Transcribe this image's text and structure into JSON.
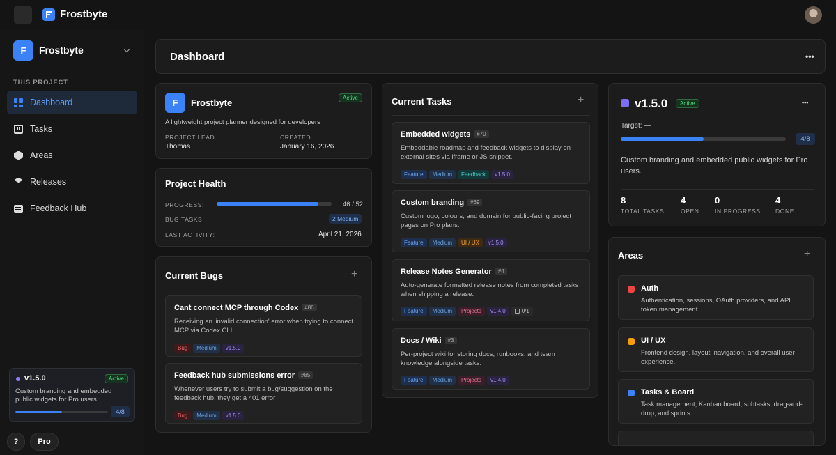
{
  "app": {
    "name": "Frostbyte"
  },
  "sidebar": {
    "project_initial": "F",
    "project_name": "Frostbyte",
    "section_label": "THIS PROJECT",
    "items": [
      {
        "label": "Dashboard",
        "icon": "dashboard-icon",
        "active": true
      },
      {
        "label": "Tasks",
        "icon": "tasks-icon"
      },
      {
        "label": "Areas",
        "icon": "cube-icon"
      },
      {
        "label": "Releases",
        "icon": "layers-icon"
      },
      {
        "label": "Feedback Hub",
        "icon": "chat-icon"
      }
    ],
    "release": {
      "version": "v1.5.0",
      "status": "Active",
      "description": "Custom branding and embedded public widgets for Pro users.",
      "progress": 0.5,
      "count": "4/8"
    },
    "help_label": "?",
    "pro_label": "Pro"
  },
  "header": {
    "title": "Dashboard",
    "more": "•••"
  },
  "project_card": {
    "initial": "F",
    "name": "Frostbyte",
    "status": "Active",
    "description": "A lightweight project planner designed for developers",
    "lead_label": "PROJECT LEAD",
    "lead": "Thomas",
    "created_label": "CREATED",
    "created": "January 16, 2026"
  },
  "health": {
    "title": "Project Health",
    "progress_label": "PROGRESS:",
    "progress": 0.885,
    "progress_text": "46 / 52",
    "bug_label": "BUG TASKS:",
    "bug_value": "2 Medium",
    "activity_label": "LAST ACTIVITY:",
    "activity_value": "April 21, 2026"
  },
  "bugs": {
    "title": "Current Bugs",
    "add": "+",
    "items": [
      {
        "title": "Cant connect MCP through Codex",
        "num": "#86",
        "desc": "Receiving an 'invalid connection' error when trying to connect MCP via Codex CLI.",
        "tags": [
          "Bug",
          "Medium",
          "v1.5.0"
        ]
      },
      {
        "title": "Feedback hub submissions error",
        "num": "#85",
        "desc": "Whenever users try to submit a bug/suggestion on the feedback hub, they get a 401 error",
        "tags": [
          "Bug",
          "Medium",
          "v1.5.0"
        ]
      }
    ]
  },
  "tasks": {
    "title": "Current Tasks",
    "add": "+",
    "items": [
      {
        "title": "Embedded widgets",
        "num": "#70",
        "desc": "Embeddable roadmap and feedback widgets to display on external sites via iframe or JS snippet.",
        "tags": [
          "Feature",
          "Medium",
          "Feedback",
          "v1.5.0"
        ]
      },
      {
        "title": "Custom branding",
        "num": "#69",
        "desc": "Custom logo, colours, and domain for public-facing project pages on Pro plans.",
        "tags": [
          "Feature",
          "Medium",
          "UI / UX",
          "v1.5.0"
        ]
      },
      {
        "title": "Release Notes Generator",
        "num": "#4",
        "desc": "Auto-generate formatted release notes from completed tasks when shipping a release.",
        "tags": [
          "Feature",
          "Medium",
          "Projects",
          "v1.4.0"
        ],
        "subtasks": "0/1"
      },
      {
        "title": "Docs / Wiki",
        "num": "#3",
        "desc": "Per-project wiki for storing docs, runbooks, and team knowledge alongside tasks.",
        "tags": [
          "Feature",
          "Medium",
          "Projects",
          "v1.4.0"
        ]
      }
    ]
  },
  "release": {
    "version": "v1.5.0",
    "status": "Active",
    "more": "•••",
    "target": "Target: —",
    "progress": 0.5,
    "count": "4/8",
    "description": "Custom branding and embedded public widgets for Pro users.",
    "stats": [
      {
        "value": "8",
        "label": "TOTAL TASKS"
      },
      {
        "value": "4",
        "label": "OPEN"
      },
      {
        "value": "0",
        "label": "IN PROGRESS"
      },
      {
        "value": "4",
        "label": "DONE"
      }
    ]
  },
  "areas": {
    "title": "Areas",
    "add": "+",
    "items": [
      {
        "name": "Auth",
        "color": "#ef4444",
        "desc": "Authentication, sessions, OAuth providers, and API token management."
      },
      {
        "name": "UI / UX",
        "color": "#f59e0b",
        "desc": "Frontend design, layout, navigation, and overall user experience."
      },
      {
        "name": "Tasks & Board",
        "color": "#3b82f6",
        "desc": "Task management, Kanban board, subtasks, drag-and-drop, and sprints."
      }
    ]
  }
}
